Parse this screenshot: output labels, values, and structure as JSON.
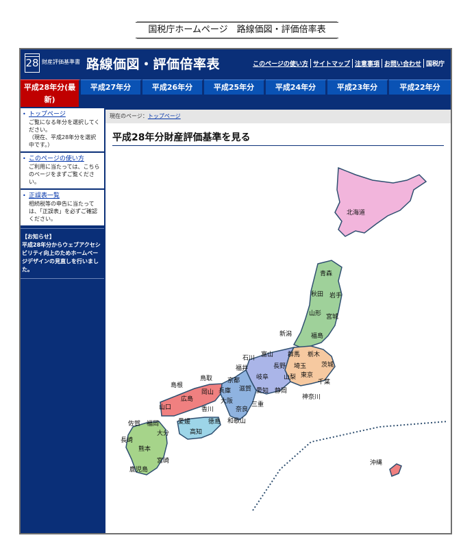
{
  "caption": "国税庁ホームページ　路線価図・評価倍率表",
  "header": {
    "logo_number": "28",
    "subtitle": "財産評価基準書",
    "title": "路線価図・評価倍率表",
    "links": [
      "このページの使い方",
      "サイトマップ",
      "注意事項",
      "お問い合わせ",
      "国税庁"
    ]
  },
  "tabs": [
    {
      "label": "平成28年分(最新)",
      "active": true
    },
    {
      "label": "平成27年分"
    },
    {
      "label": "平成26年分"
    },
    {
      "label": "平成25年分"
    },
    {
      "label": "平成24年分"
    },
    {
      "label": "平成23年分"
    },
    {
      "label": "平成22年分"
    }
  ],
  "sidebar": {
    "items": [
      {
        "link": "トップページ",
        "text": "ご覧になる年分を選択してください。\n（現在、平成28年分を選択中です。）"
      },
      {
        "link": "このページの使い方",
        "text": "ご利用に当たっては、こちらのページをまずご覧ください。"
      },
      {
        "link": "正誤表一覧",
        "text": "相続税等の申告に当たっては、「正誤表」を必ずご確認ください。"
      }
    ],
    "notice_title": "【お知らせ】",
    "notice_text": "平成28年分からウェブアクセシビリティ向上のためホームページデザインの見直しを行いました。"
  },
  "main": {
    "breadcrumb_label": "現在のページ：",
    "breadcrumb_link": "トップページ",
    "page_title": "平成28年分財産評価基準を見る"
  },
  "map": {
    "prefectures": {
      "hokkaido": "北海道",
      "aomori": "青森",
      "akita": "秋田",
      "iwate": "岩手",
      "yamagata": "山形",
      "miyagi": "宮城",
      "niigata": "新潟",
      "fukushima": "福島",
      "ishikawa": "石川",
      "toyama": "富山",
      "gunma": "群馬",
      "tochigi": "栃木",
      "ibaraki": "茨城",
      "fukui": "福井",
      "nagano": "長野",
      "saitama": "埼玉",
      "tottori": "鳥取",
      "kyoto": "京都",
      "gifu": "岐阜",
      "yamanashi": "山梨",
      "tokyo": "東京",
      "chiba": "千葉",
      "shimane": "島根",
      "okayama": "岡山",
      "hyogo": "兵庫",
      "shiga": "滋賀",
      "aichi": "愛知",
      "shizuoka": "静岡",
      "kanagawa": "神奈川",
      "hiroshima": "広島",
      "yamaguchi": "山口",
      "osaka": "大阪",
      "kagawa": "香川",
      "nara": "奈良",
      "mie": "三重",
      "ehime": "愛媛",
      "tokushima": "徳島",
      "kochi": "高知",
      "wakayama": "和歌山",
      "saga": "佐賀",
      "fukuoka": "福岡",
      "oita": "大分",
      "nagasaki": "長崎",
      "kumamoto": "熊本",
      "miyazaki": "宮崎",
      "kagoshima": "鹿児島",
      "okinawa": "沖縄"
    },
    "colors": {
      "hokkaido": "#f2b5dc",
      "tohoku": "#9fd19a",
      "kanto": "#f6c9a0",
      "chubu": "#aab5e8",
      "kinki": "#8fb3e0",
      "chugoku": "#f08080",
      "shikoku": "#9dd5e8",
      "kyushu": "#a6d48a",
      "okinawa": "#f08080",
      "border": "#2f4f70"
    }
  }
}
